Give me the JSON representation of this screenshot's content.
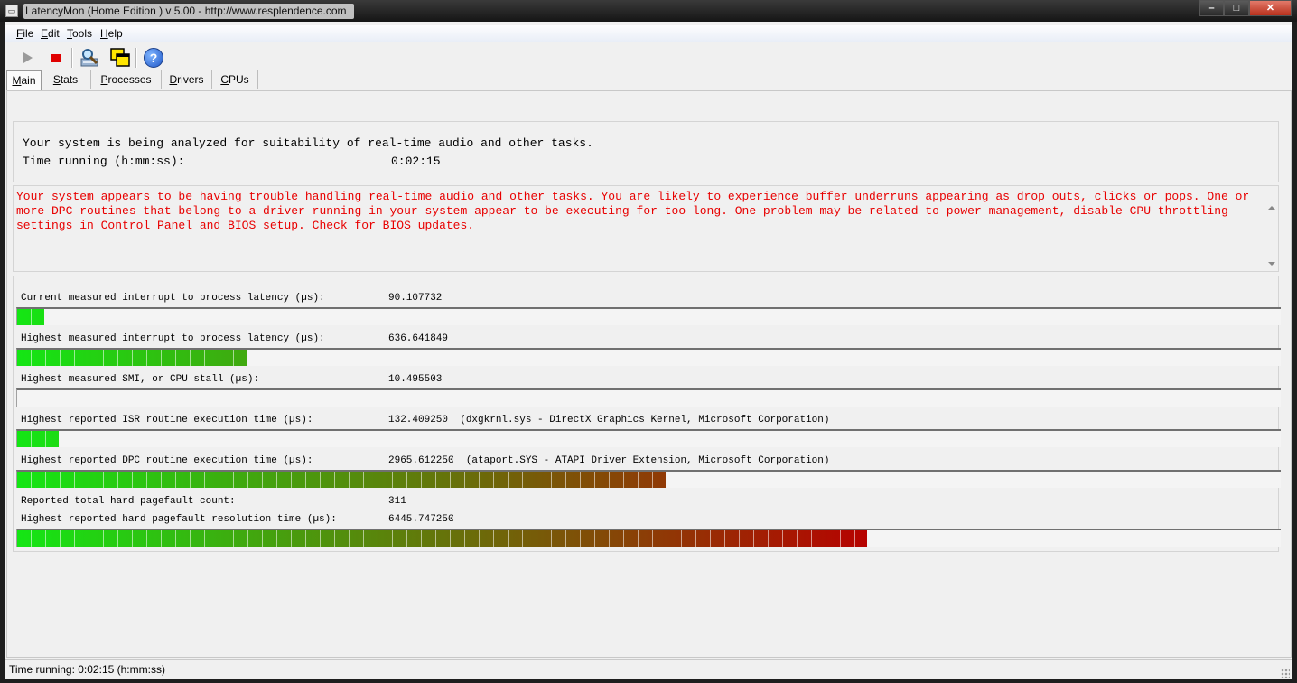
{
  "window": {
    "title": "LatencyMon  (Home Edition )  v 5.00 - http://www.resplendence.com",
    "min_glyph": "–",
    "max_glyph": "□",
    "close_glyph": "✕"
  },
  "menu": [
    {
      "key": "F",
      "rest": "ile"
    },
    {
      "key": "E",
      "rest": "dit"
    },
    {
      "key": "T",
      "rest": "ools"
    },
    {
      "key": "H",
      "rest": "elp"
    }
  ],
  "toolbar": {
    "icons": [
      "play-icon",
      "stop-icon",
      "analyze-icon",
      "copy-window-icon",
      "help-icon"
    ],
    "help_glyph": "?"
  },
  "tabs": [
    {
      "key": "M",
      "rest": "ain",
      "active": true
    },
    {
      "key": "S",
      "rest": "tats",
      "active": false
    },
    {
      "key": "P",
      "rest": "rocesses",
      "active": false
    },
    {
      "key": "D",
      "rest": "rivers",
      "active": false
    },
    {
      "key": "C",
      "rest": "PUs",
      "active": false
    }
  ],
  "status_panel": {
    "line1": "Your system is being analyzed for suitability of real-time audio and other tasks.",
    "time_label": "Time running (h:mm:ss):",
    "time_value": "0:02:15"
  },
  "conclusion": {
    "text": "Your system appears to be having trouble handling real-time audio and other tasks. You are likely to experience buffer underruns appearing as drop outs, clicks or pops. One or more DPC routines that belong to a driver running in your system appear to be executing for too long. One problem may be related to power management, disable CPU throttling settings in Control Panel and BIOS setup. Check for BIOS updates."
  },
  "metrics": [
    {
      "label": "Current measured interrupt to process latency (µs):",
      "value": "90.107732",
      "bar_fraction": 0.0214
    },
    {
      "label": "Highest measured interrupt to process latency (µs):",
      "value": "636.641849",
      "bar_fraction": 0.1814
    },
    {
      "label": "Highest measured SMI, or CPU stall (µs):",
      "value": "10.495503",
      "bar_fraction": 0
    },
    {
      "label": "Highest reported ISR routine execution time (µs):",
      "value": "132.409250  (dxgkrnl.sys - DirectX Graphics Kernel, Microsoft Corporation)",
      "bar_fraction": 0.0329
    },
    {
      "label": "Highest reported DPC routine execution time (µs):",
      "value": "2965.612250  (ataport.SYS - ATAPI Driver Extension, Microsoft Corporation)",
      "bar_fraction": 0.5129
    },
    {
      "label": "Reported total hard pagefault count:",
      "value": "311"
    },
    {
      "label": "Highest reported hard pagefault resolution time (µs):",
      "value": "6445.747250",
      "bar_fraction": 0.6729
    }
  ],
  "statusbar": {
    "text": "Time running: 0:02:15  (h:mm:ss)"
  },
  "colors": {
    "warning_text": "#e80000",
    "bar_green": "#14e614",
    "bar_red": "#b80000"
  }
}
